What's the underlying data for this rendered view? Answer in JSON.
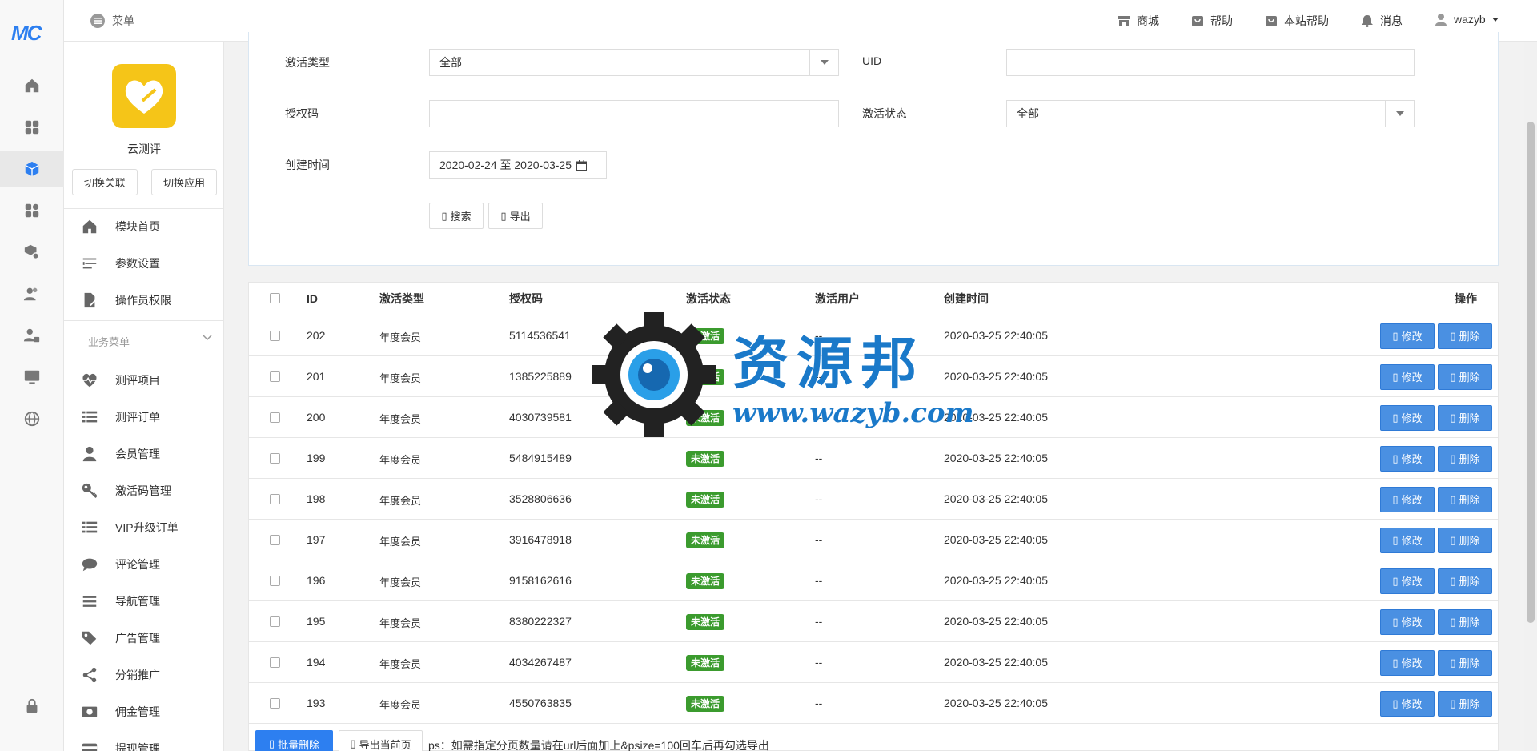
{
  "brand": {
    "logo_text": "MC"
  },
  "topbar": {
    "menu_label": "菜单",
    "items": [
      {
        "label": "商城",
        "icon": "store-icon"
      },
      {
        "label": "帮助",
        "icon": "help-bag-icon"
      },
      {
        "label": "本站帮助",
        "icon": "site-help-icon"
      },
      {
        "label": "消息",
        "icon": "bell-icon"
      },
      {
        "label": "wazyb",
        "icon": "user-icon"
      }
    ]
  },
  "rail": {
    "icons": [
      "home-icon",
      "apps-grid-icon",
      "cube-icon",
      "widgets-icon",
      "package-settings-icon",
      "users-icon",
      "user-lock-icon",
      "monitor-icon",
      "globe-icon",
      "lock-icon"
    ],
    "active_index": 2
  },
  "sidebar": {
    "app_name": "云测评",
    "switch_link": "切换关联",
    "switch_app": "切换应用",
    "top_items": [
      {
        "label": "模块首页",
        "icon": "home-icon"
      },
      {
        "label": "参数设置",
        "icon": "sliders-icon"
      },
      {
        "label": "操作员权限",
        "icon": "file-edit-icon"
      }
    ],
    "section_title": "业务菜单",
    "biz_items": [
      {
        "label": "测评项目",
        "icon": "heart-pulse-icon"
      },
      {
        "label": "测评订单",
        "icon": "list-icon"
      },
      {
        "label": "会员管理",
        "icon": "user-icon"
      },
      {
        "label": "激活码管理",
        "icon": "key-icon"
      },
      {
        "label": "VIP升级订单",
        "icon": "list-icon"
      },
      {
        "label": "评论管理",
        "icon": "comment-icon"
      },
      {
        "label": "导航管理",
        "icon": "bars-icon"
      },
      {
        "label": "广告管理",
        "icon": "tags-icon"
      },
      {
        "label": "分销推广",
        "icon": "share-icon"
      },
      {
        "label": "佣金管理",
        "icon": "money-icon"
      },
      {
        "label": "提现管理",
        "icon": "card-icon"
      }
    ]
  },
  "filter": {
    "type_label": "激活类型",
    "type_value": "全部",
    "uid_label": "UID",
    "uid_value": "",
    "code_label": "授权码",
    "code_value": "",
    "status_label": "激活状态",
    "status_value": "全部",
    "created_label": "创建时间",
    "created_value": "2020-02-24 至 2020-03-25",
    "search_btn": "搜索",
    "export_btn": "导出"
  },
  "table": {
    "headers": {
      "id": "ID",
      "type": "激活类型",
      "code": "授权码",
      "status": "激活状态",
      "user": "激活用户",
      "created": "创建时间",
      "action": "操作"
    },
    "edit_label": "修改",
    "delete_label": "删除",
    "rows": [
      {
        "id": "202",
        "type": "年度会员",
        "code": "5114536541",
        "status": "未激活",
        "user": "--",
        "created": "2020-03-25 22:40:05"
      },
      {
        "id": "201",
        "type": "年度会员",
        "code": "1385225889",
        "status": "未激活",
        "user": "--",
        "created": "2020-03-25 22:40:05"
      },
      {
        "id": "200",
        "type": "年度会员",
        "code": "4030739581",
        "status": "未激活",
        "user": "--",
        "created": "2020-03-25 22:40:05"
      },
      {
        "id": "199",
        "type": "年度会员",
        "code": "5484915489",
        "status": "未激活",
        "user": "--",
        "created": "2020-03-25 22:40:05"
      },
      {
        "id": "198",
        "type": "年度会员",
        "code": "3528806636",
        "status": "未激活",
        "user": "--",
        "created": "2020-03-25 22:40:05"
      },
      {
        "id": "197",
        "type": "年度会员",
        "code": "3916478918",
        "status": "未激活",
        "user": "--",
        "created": "2020-03-25 22:40:05"
      },
      {
        "id": "196",
        "type": "年度会员",
        "code": "9158162616",
        "status": "未激活",
        "user": "--",
        "created": "2020-03-25 22:40:05"
      },
      {
        "id": "195",
        "type": "年度会员",
        "code": "8380222327",
        "status": "未激活",
        "user": "--",
        "created": "2020-03-25 22:40:05"
      },
      {
        "id": "194",
        "type": "年度会员",
        "code": "4034267487",
        "status": "未激活",
        "user": "--",
        "created": "2020-03-25 22:40:05"
      },
      {
        "id": "193",
        "type": "年度会员",
        "code": "4550763835",
        "status": "未激活",
        "user": "--",
        "created": "2020-03-25 22:40:05"
      }
    ],
    "bulk_delete": "批量删除",
    "export_page": "导出当前页",
    "note": "ps：如需指定分页数量请在url后面加上&psize=100回车后再勾选导出"
  },
  "watermark": {
    "title": "资源邦",
    "url": "www.wazyb.com"
  },
  "colors": {
    "primary": "#2d7ff0",
    "badge": "#3b9b2e",
    "action_btn": "#4a90e2",
    "app_logo": "#f5c518"
  }
}
